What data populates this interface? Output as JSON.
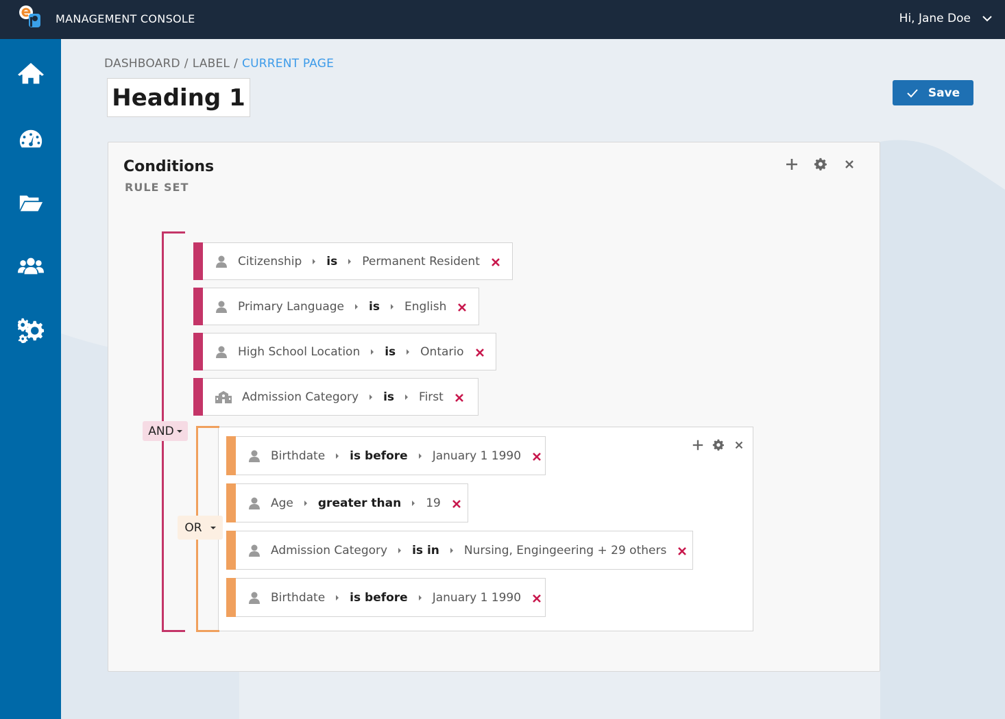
{
  "header": {
    "title": "MANAGEMENT CONSOLE",
    "greeting": "Hi, Jane Doe",
    "logo_icon": "ep-logo",
    "menu_icon": "chevron-down-icon"
  },
  "sidebar": {
    "items": [
      {
        "name": "home",
        "icon": "home-icon"
      },
      {
        "name": "dashboard",
        "icon": "dashboard-icon"
      },
      {
        "name": "files",
        "icon": "folder-icon"
      },
      {
        "name": "users",
        "icon": "users-icon"
      },
      {
        "name": "settings",
        "icon": "gears-icon"
      }
    ]
  },
  "breadcrumb": {
    "items": [
      "DASHBOARD",
      "LABEL"
    ],
    "current": "CURRENT PAGE",
    "separator": "/"
  },
  "page": {
    "heading": "Heading 1",
    "save_label": "Save"
  },
  "card": {
    "title": "Conditions",
    "subtitle": "RULE SET"
  },
  "logic": {
    "outer": "AND",
    "inner": "OR"
  },
  "rules_and": [
    {
      "field": "Citizenship",
      "operator": "is",
      "value": "Permanent Resident",
      "icon": "person-icon"
    },
    {
      "field": "Primary Language",
      "operator": "is",
      "value": "English",
      "icon": "person-icon"
    },
    {
      "field": "High School Location",
      "operator": "is",
      "value": "Ontario",
      "icon": "person-icon"
    },
    {
      "field": "Admission Category",
      "operator": "is",
      "value": "First",
      "icon": "school-icon"
    }
  ],
  "rules_or": [
    {
      "field": "Birthdate",
      "operator": "is before",
      "value": "January 1 1990",
      "icon": "person-icon"
    },
    {
      "field": "Age",
      "operator": "greater than",
      "value": "19",
      "icon": "person-icon"
    },
    {
      "field": "Admission Category",
      "operator": "is in",
      "value": "Nursing, Engingeering + 29 others",
      "icon": "person-icon"
    },
    {
      "field": "Birthdate",
      "operator": "is before",
      "value": "January 1 1990",
      "icon": "person-icon"
    }
  ],
  "colors": {
    "topbar": "#1b2a3d",
    "sidebar": "#0069a8",
    "and_accent": "#c43568",
    "or_accent": "#f0a05d",
    "link": "#3d9be9",
    "delete": "#c8174c",
    "save": "#1e70b3"
  }
}
